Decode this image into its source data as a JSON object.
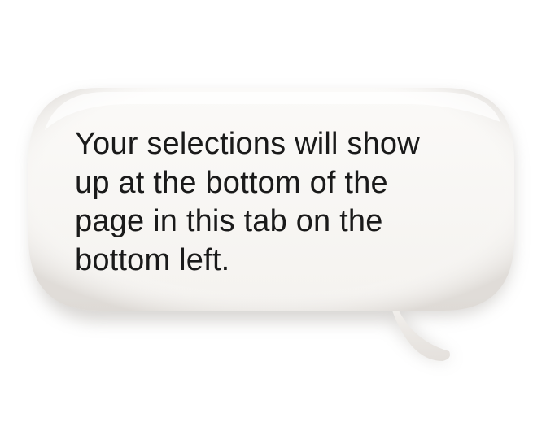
{
  "tooltip": {
    "lines": [
      "Your selections will show",
      "up at the bottom of the",
      "page in this tab on the",
      "bottom left."
    ]
  },
  "colors": {
    "bubble_fill": "#f7f5f2",
    "bubble_shadow": "#b9b5b0",
    "text": "#1a1a1a"
  }
}
